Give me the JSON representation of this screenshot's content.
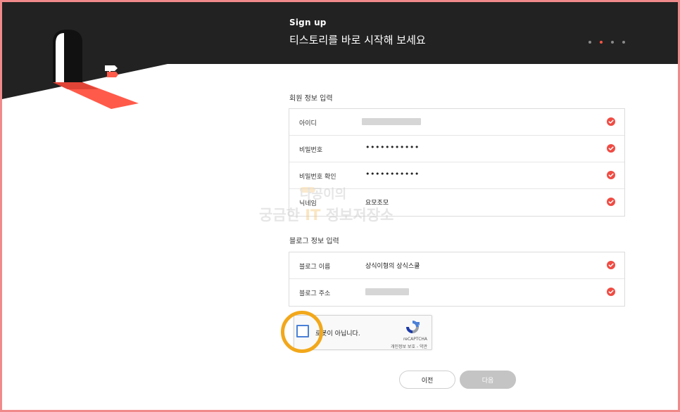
{
  "hero": {
    "subtitle": "Sign up",
    "title": "티스토리를 바로 시작해 보세요",
    "steps": [
      {
        "icon": "step-dot",
        "active": false
      },
      {
        "icon": "step-dot",
        "active": true
      },
      {
        "icon": "step-dot",
        "active": false
      },
      {
        "icon": "step-dot",
        "active": false
      }
    ]
  },
  "member_section": {
    "title": "회원 정보 입력",
    "rows": [
      {
        "label": "아이디",
        "value": "",
        "masked": false,
        "blurred": true
      },
      {
        "label": "비밀번호",
        "value": "•••••••••••",
        "masked": true
      },
      {
        "label": "비밀번호 확인",
        "value": "•••••••••••",
        "masked": true
      },
      {
        "label": "닉네임",
        "value": "요모조모",
        "masked": false
      }
    ]
  },
  "blog_section": {
    "title": "블로그 정보 입력",
    "rows": [
      {
        "label": "블로그 이름",
        "value": "상식이형의 상식스쿨"
      },
      {
        "label": "블로그 주소",
        "value": "",
        "blurred": true
      }
    ]
  },
  "captcha": {
    "label": "로봇이 아닙니다.",
    "brand": "reCAPTCHA",
    "links": "개인정보 보호 - 약관",
    "checked": false
  },
  "buttons": {
    "prev": "이전",
    "next": "다음"
  },
  "watermark": {
    "line1": "나공이의",
    "line2_a": "궁금한",
    "line2_b": "IT",
    "line2_c": "정보저장소"
  },
  "colors": {
    "hero_bg": "#222222",
    "accent": "#ef4b43",
    "highlight": "#f2a81b",
    "frame": "#f08a8a",
    "captcha_blue": "#4a80d8"
  },
  "icons": {
    "row_status": "check-circle-icon",
    "captcha_logo": "recaptcha-logo-icon",
    "hero_art": "door-signpost-illustration"
  }
}
